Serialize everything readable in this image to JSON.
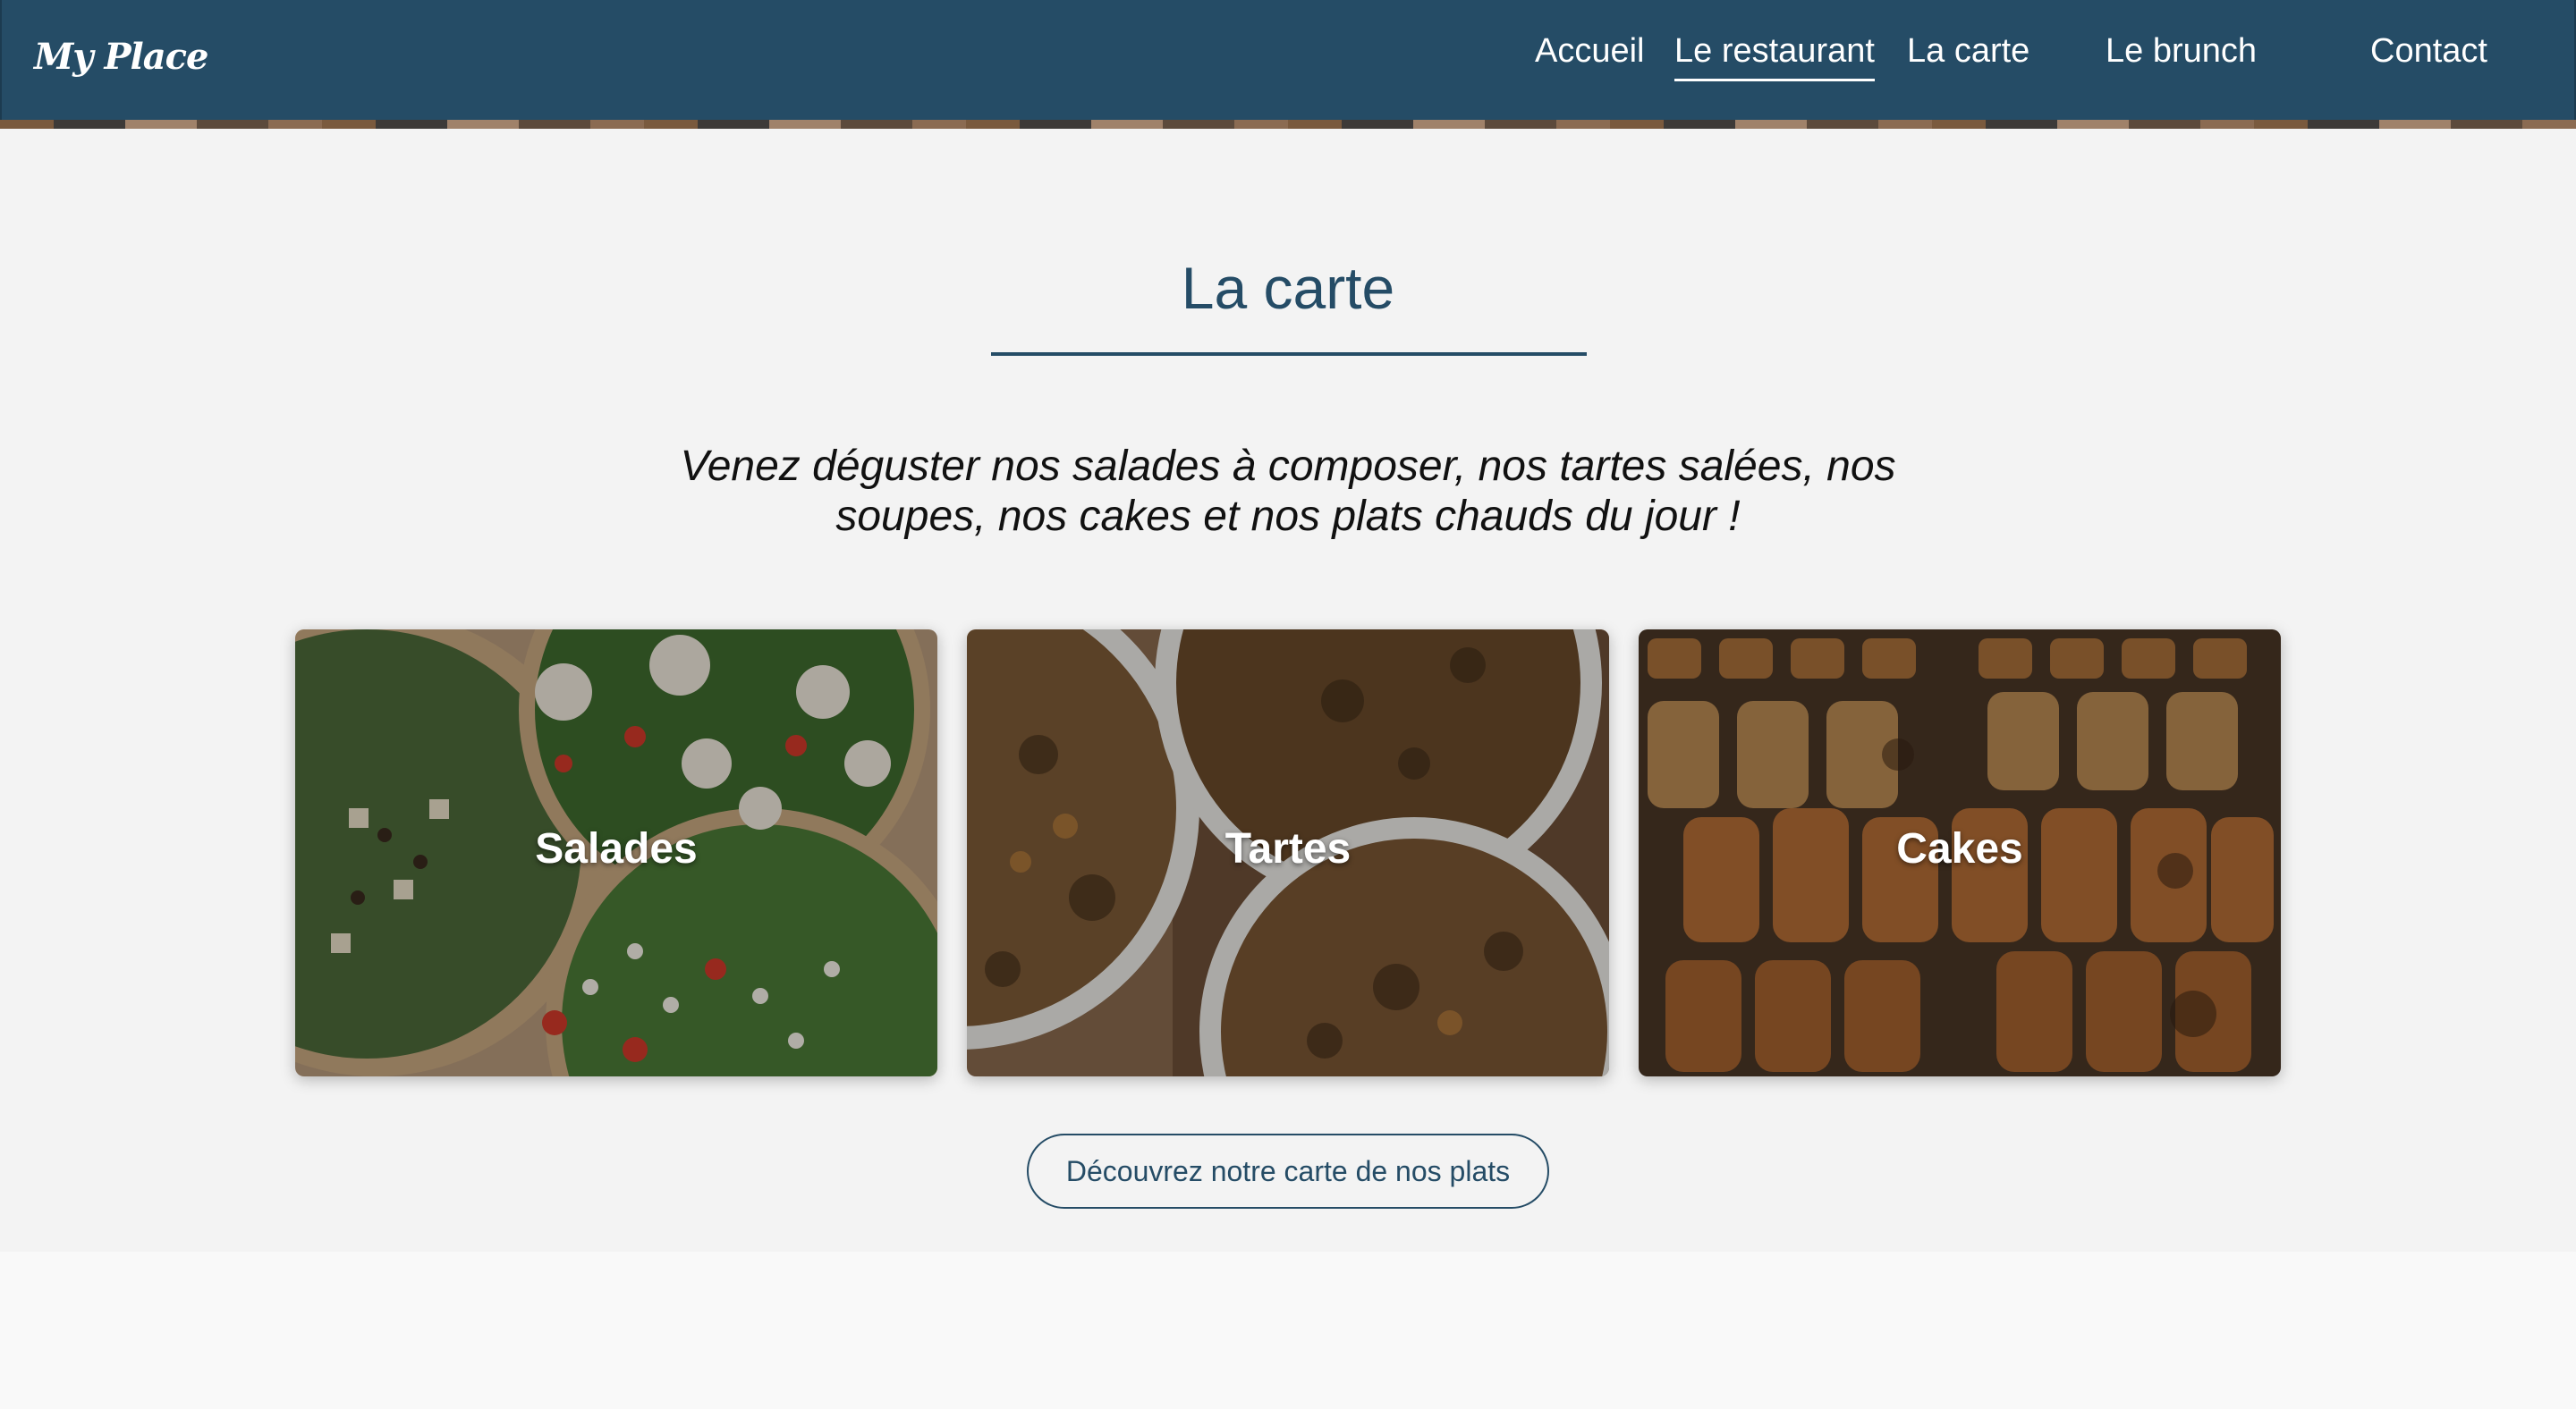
{
  "header": {
    "logo": "My Place",
    "nav": [
      {
        "label": "Accueil"
      },
      {
        "label": "Le restaurant",
        "active": true
      },
      {
        "label": "La carte"
      },
      {
        "label": "Le brunch"
      },
      {
        "label": "Contact"
      }
    ]
  },
  "menu_section": {
    "title": "La carte",
    "lead": "Venez déguster nos salades à composer, nos tartes salées, nos soupes, nos cakes et nos plats chauds du jour !",
    "cards": [
      {
        "label": "Salades"
      },
      {
        "label": "Tartes"
      },
      {
        "label": "Cakes"
      }
    ],
    "cta_label": "Découvrez notre carte de nos plats"
  },
  "colors": {
    "brand": "#254c66",
    "section_bg": "#f3f3f3",
    "page_bg": "#f9f9f9"
  }
}
